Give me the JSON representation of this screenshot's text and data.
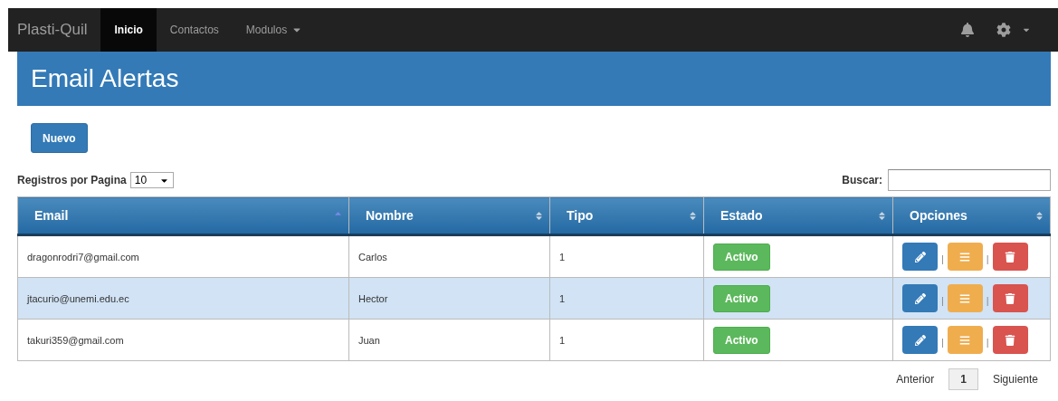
{
  "navbar": {
    "brand": "Plasti-Quil",
    "items": [
      {
        "label": "Inicio",
        "selected": true,
        "dropdown": false
      },
      {
        "label": "Contactos",
        "selected": false,
        "dropdown": false
      },
      {
        "label": "Modulos",
        "selected": false,
        "dropdown": true
      }
    ]
  },
  "page_title": "Email Alertas",
  "new_button": "Nuevo",
  "page_size": {
    "label": "Registros por Pagina",
    "value": "10"
  },
  "search": {
    "label": "Buscar:"
  },
  "table": {
    "columns": [
      {
        "label": "Email",
        "sorted": true
      },
      {
        "label": "Nombre",
        "sorted": false
      },
      {
        "label": "Tipo",
        "sorted": false
      },
      {
        "label": "Estado",
        "sorted": false
      },
      {
        "label": "Opciones",
        "sorted": false
      }
    ],
    "action_separator": "|",
    "rows": [
      {
        "email": "dragonrodri7@gmail.com",
        "nombre": "Carlos",
        "tipo": "1",
        "estado": "Activo",
        "selected": false
      },
      {
        "email": "jtacurio@unemi.edu.ec",
        "nombre": "Hector",
        "tipo": "1",
        "estado": "Activo",
        "selected": true
      },
      {
        "email": "takuri359@gmail.com",
        "nombre": "Juan",
        "tipo": "1",
        "estado": "Activo",
        "selected": false
      }
    ]
  },
  "pagination": {
    "previous": "Anterior",
    "pages": [
      {
        "label": "1",
        "selected": true
      }
    ],
    "next": "Siguiente"
  }
}
